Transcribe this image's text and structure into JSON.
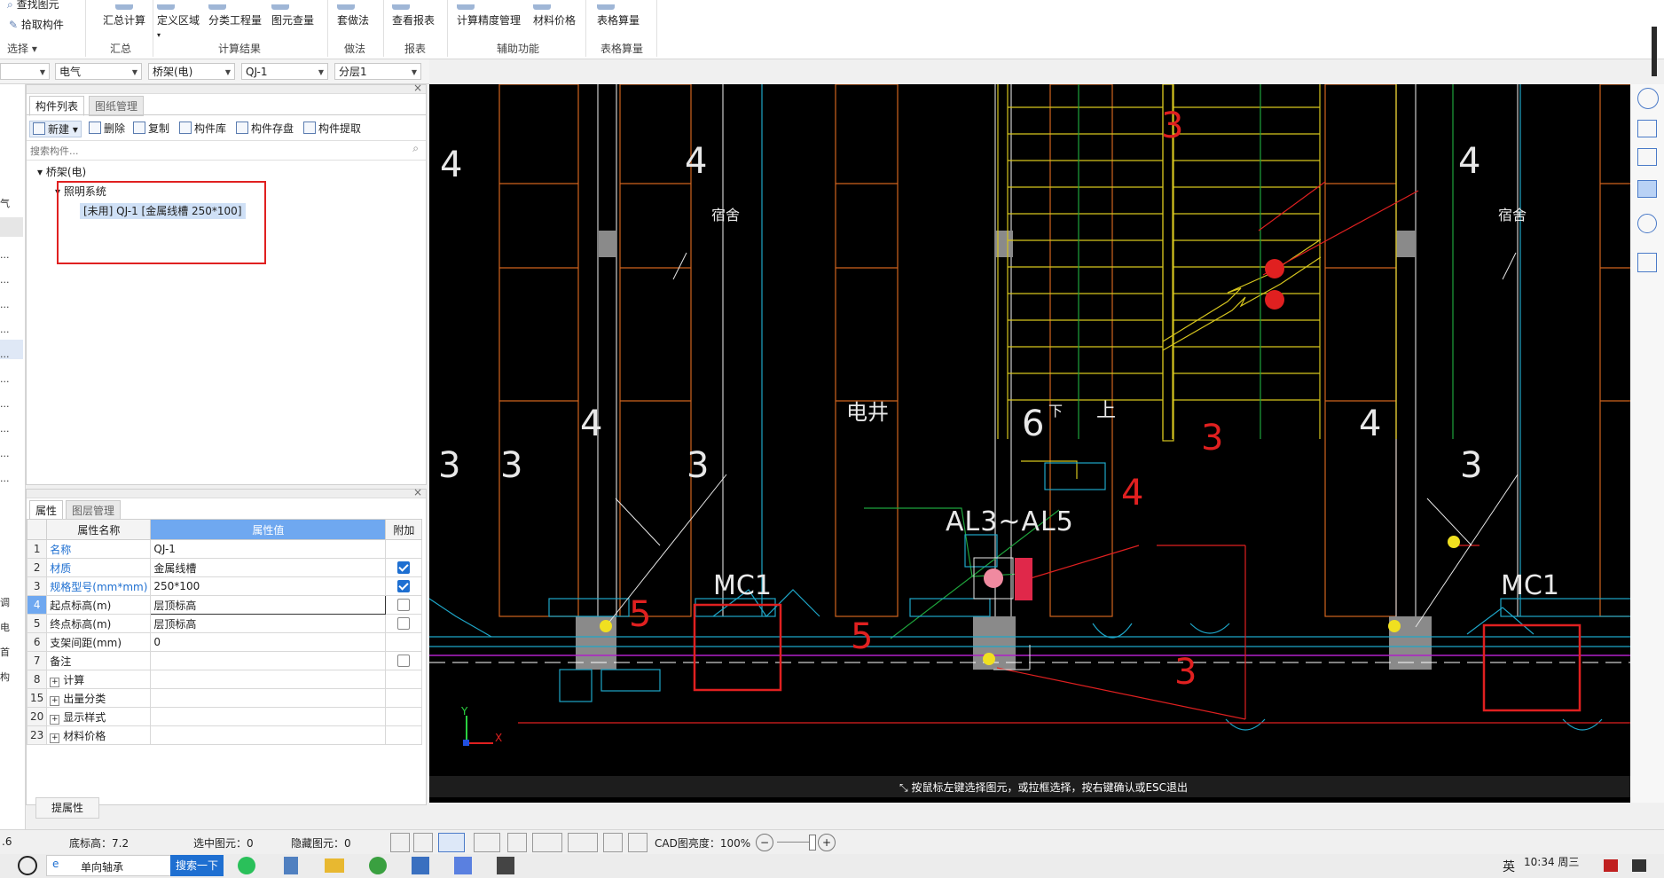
{
  "ribbon": {
    "buttons": [
      "查找图元",
      "拾取构件",
      "汇总计算",
      "定义区域",
      "分类工程量",
      "图元查量",
      "套做法",
      "查看报表",
      "计算精度管理",
      "材料价格",
      "表格算量"
    ],
    "groups": [
      "选择",
      "汇总",
      "计算结果",
      "做法",
      "报表",
      "辅助功能",
      "表格算量"
    ]
  },
  "filters": [
    "电气",
    "桥架(电)",
    "QJ-1",
    "分层1"
  ],
  "left_strip": [
    "气",
    "...",
    "...",
    "...",
    "...",
    "...",
    "...",
    "...",
    "...",
    "...",
    "...",
    "调",
    "电",
    "首",
    "构"
  ],
  "comp_panel": {
    "tabs": [
      "构件列表",
      "图纸管理"
    ],
    "toolbar": [
      "新建",
      "删除",
      "复制",
      "构件库",
      "构件存盘",
      "构件提取"
    ],
    "search_placeholder": "搜索构件...",
    "tree_root": "桥架(电)",
    "tree_child": "照明系统",
    "tree_leaf": "[未用] QJ-1 [金属线槽 250*100]"
  },
  "prop_panel": {
    "tabs": [
      "属性",
      "图层管理"
    ],
    "headers": [
      "属性名称",
      "属性值",
      "附加"
    ],
    "rows": [
      {
        "no": "1",
        "name": "名称",
        "value": "QJ-1",
        "link": true,
        "check": null
      },
      {
        "no": "2",
        "name": "材质",
        "value": "金属线槽",
        "link": true,
        "check": true
      },
      {
        "no": "3",
        "name": "规格型号(mm*mm)",
        "value": "250*100",
        "link": true,
        "check": true
      },
      {
        "no": "4",
        "name": "起点标高(m)",
        "value": "层顶标高",
        "link": false,
        "check": false
      },
      {
        "no": "5",
        "name": "终点标高(m)",
        "value": "层顶标高",
        "link": false,
        "check": false
      },
      {
        "no": "6",
        "name": "支架间距(mm)",
        "value": "0",
        "link": false,
        "check": null
      },
      {
        "no": "7",
        "name": "备注",
        "value": "",
        "link": false,
        "check": false
      },
      {
        "no": "8",
        "name": "计算",
        "value": "",
        "link": false,
        "check": null,
        "expand": true
      },
      {
        "no": "15",
        "name": "出量分类",
        "value": "",
        "link": false,
        "check": null,
        "expand": true
      },
      {
        "no": "20",
        "name": "显示样式",
        "value": "",
        "link": false,
        "check": null,
        "expand": true
      },
      {
        "no": "23",
        "name": "材料价格",
        "value": "",
        "link": false,
        "check": null,
        "expand": true
      }
    ],
    "footer_button": "提属性"
  },
  "cad": {
    "labels": {
      "dorm": "宿舍",
      "shaft": "电井",
      "up": "上",
      "down": "下",
      "panel": "AL3~AL5",
      "mc": "MC1"
    },
    "numbers": [
      "4",
      "4",
      "4",
      "3",
      "3",
      "3",
      "4",
      "4",
      "4",
      "3",
      "3",
      "5",
      "5",
      "6",
      "3",
      "3"
    ],
    "axis": {
      "x": "X",
      "y": "Y"
    },
    "hint": "按鼠标左键选择图元，或拉框选择，按右键确认或ESC退出"
  },
  "status": {
    "left_value": ".6",
    "base_elev": "底标高：7.2",
    "selected": "选中图元：0",
    "hidden": "隐藏图元：0",
    "cad_brightness": "CAD图亮度：100%"
  },
  "taskbar": {
    "search_text": "单向轴承",
    "search_button": "搜索一下",
    "ime": "英",
    "time": "10:34 周三"
  },
  "colors": {
    "accent": "#1e6fd1",
    "highlight_red": "#e02020",
    "cad_bg": "#000000"
  }
}
